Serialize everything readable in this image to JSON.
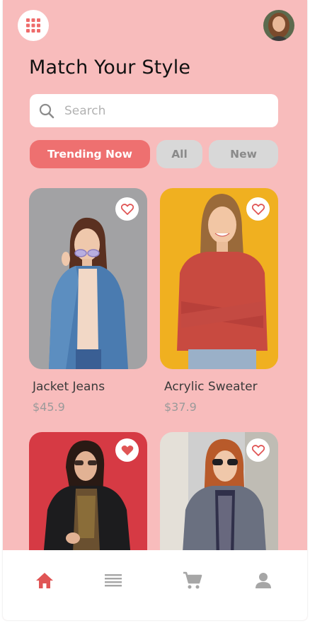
{
  "header": {
    "title": "Match Your Style",
    "menu_icon": "grid-icon",
    "avatar_icon": "user-avatar"
  },
  "search": {
    "placeholder": "Search",
    "value": ""
  },
  "filters": [
    {
      "label": "Trending Now",
      "active": true
    },
    {
      "label": "All",
      "active": false
    },
    {
      "label": "New",
      "active": false
    }
  ],
  "products": [
    {
      "name": "Jacket Jeans",
      "price": "$45.9",
      "favorited": false,
      "bg": "#9a9a9c"
    },
    {
      "name": "Acrylic Sweater",
      "price": "$37.9",
      "favorited": false,
      "bg": "#f0b020"
    },
    {
      "name": "",
      "price": "",
      "favorited": true,
      "bg": "#d63a44"
    },
    {
      "name": "",
      "price": "",
      "favorited": false,
      "bg": "#cfcfcf"
    }
  ],
  "tabbar": [
    {
      "icon": "home-icon",
      "active": true
    },
    {
      "icon": "list-icon",
      "active": false
    },
    {
      "icon": "cart-icon",
      "active": false
    },
    {
      "icon": "profile-icon",
      "active": false
    }
  ],
  "colors": {
    "background": "#f8bcbc",
    "accent": "#ee7070",
    "chip_inactive": "#d8d8d8",
    "icon_inactive": "#a6a6a6"
  }
}
